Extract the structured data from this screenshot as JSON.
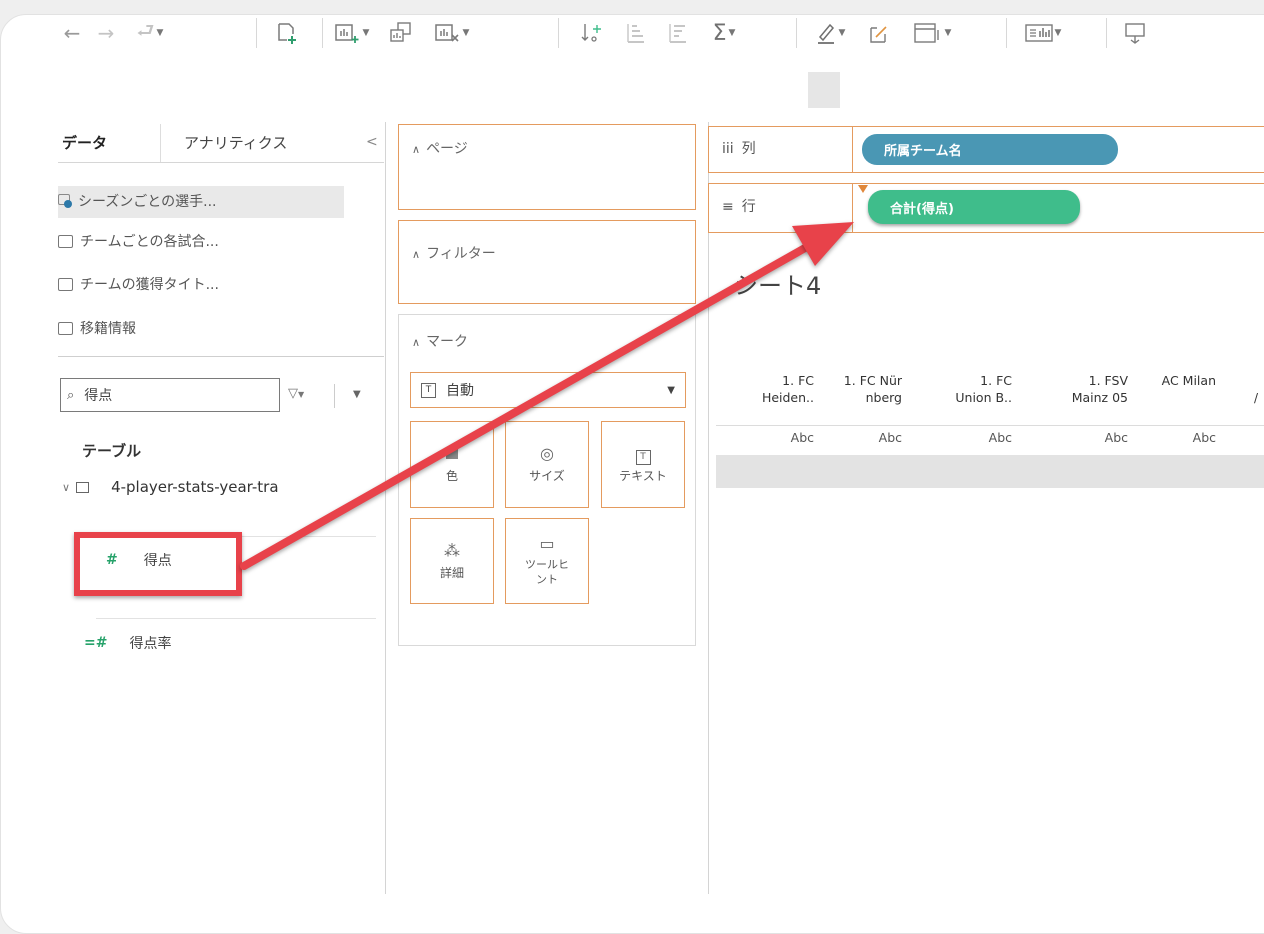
{
  "toolbar": {
    "icons": [
      "back-icon",
      "forward-icon",
      "redo-icon",
      "new-datasource-icon",
      "new-worksheet-icon",
      "duplicate-icon",
      "clear-sheet-icon",
      "swap-icon",
      "sort-asc-icon",
      "sort-desc-icon",
      "sum-icon",
      "highlight-icon",
      "annotate-icon",
      "fit-icon",
      "show-me-icon",
      "presentation-icon"
    ]
  },
  "data_pane": {
    "tab_data": "データ",
    "tab_analytics": "アナリティクス",
    "collapse_glyph": "<",
    "datasources": [
      {
        "label": "シーズンごとの選手..."
      },
      {
        "label": "チームごとの各試合..."
      },
      {
        "label": "チームの獲得タイト..."
      },
      {
        "label": "移籍情報"
      }
    ],
    "search_value": "得点",
    "section_title": "テーブル",
    "table_name": "4-player-stats-year-tra",
    "fields": [
      {
        "label": "得点",
        "symbol": "#"
      },
      {
        "label": "得点率",
        "symbol": "=#"
      }
    ]
  },
  "shelves": {
    "pages_label": "ページ",
    "filters_label": "フィルター",
    "marks_label": "マーク",
    "mark_type": "自動",
    "mark_buttons": [
      {
        "label": "色"
      },
      {
        "label": "サイズ"
      },
      {
        "label": "テキスト"
      },
      {
        "label": "詳細"
      },
      {
        "label": "ツールヒント"
      }
    ],
    "columns_label": "列",
    "rows_label": "行",
    "columns_pill": "所属チーム名",
    "rows_pill": "合計(得点)",
    "colors": {
      "columns_pill": "#4a97b4",
      "rows_pill": "#3fbd8b",
      "shelf_border": "#e49b5f",
      "highlight": "#e8424a"
    }
  },
  "view": {
    "sheet_title": "シート4",
    "columns": [
      {
        "line1": "1. FC",
        "line2": "Heiden..",
        "abc": "Abc"
      },
      {
        "line1": "1. FC Nür",
        "line2": "nberg",
        "abc": "Abc"
      },
      {
        "line1": "1. FC",
        "line2": "Union B..",
        "abc": "Abc"
      },
      {
        "line1": "1. FSV",
        "line2": "Mainz 05",
        "abc": "Abc"
      },
      {
        "line1": "",
        "line2": "AC Milan",
        "abc": "Abc"
      }
    ]
  }
}
